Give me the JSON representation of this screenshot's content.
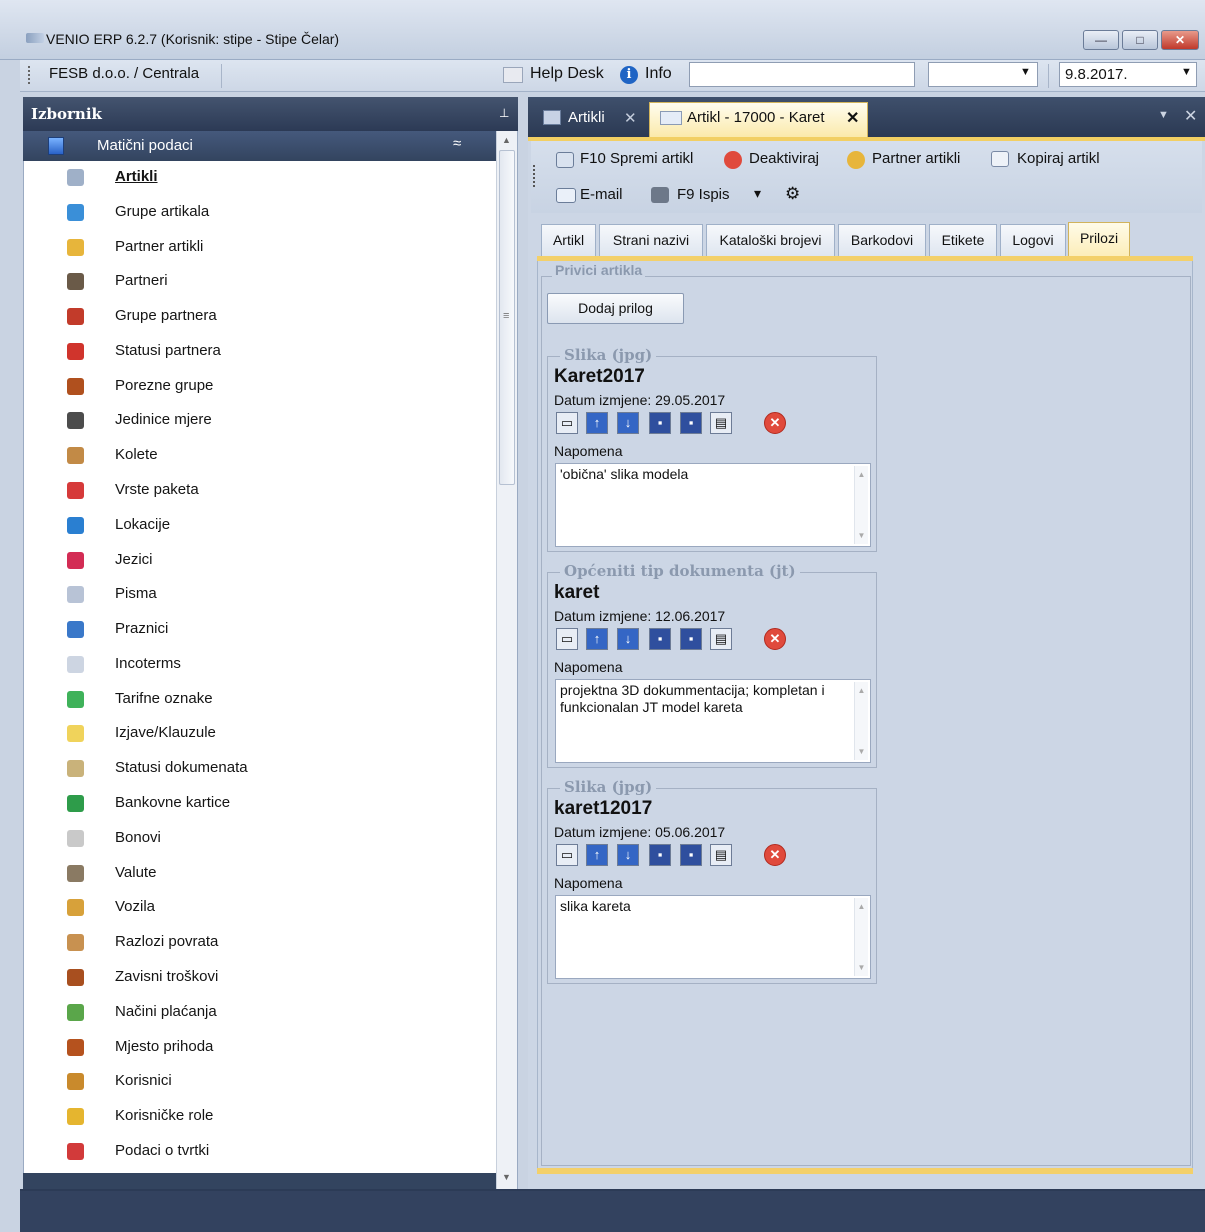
{
  "window": {
    "title": "VENIO ERP 6.2.7 (Korisnik: stipe - Stipe Čelar)",
    "minimize": "—",
    "maximize": "□",
    "close": "✕"
  },
  "topbar": {
    "company": "FESB d.o.o. / Centrala",
    "help_desk": "Help Desk",
    "info": "Info",
    "info_icon": "i",
    "search_value": "",
    "combo_value": "",
    "date": "9.8.2017.",
    "dropdown_glyph": "▼"
  },
  "sidebar": {
    "title": "Izbornik",
    "pin": "⊥",
    "group_title": "Matični podaci",
    "group_collapse": "≈",
    "scroll_up": "▲",
    "scroll_down": "▼",
    "scroll_grip": "≡",
    "items": [
      {
        "label": "Artikli",
        "icon": "articles-icon",
        "color": "#9fb0c8"
      },
      {
        "label": "Grupe artikala",
        "icon": "article-groups-icon",
        "color": "#3a8fd8"
      },
      {
        "label": "Partner artikli",
        "icon": "partner-articles-icon",
        "color": "#e7b53b"
      },
      {
        "label": "Partneri",
        "icon": "partners-icon",
        "color": "#6a5a48"
      },
      {
        "label": "Grupe partnera",
        "icon": "partner-groups-icon",
        "color": "#c23b2a"
      },
      {
        "label": "Statusi partnera",
        "icon": "partner-status-icon",
        "color": "#d0342c"
      },
      {
        "label": "Porezne grupe",
        "icon": "tax-groups-icon",
        "color": "#b0501e"
      },
      {
        "label": "Jedinice mjere",
        "icon": "units-icon",
        "color": "#4c4c4c"
      },
      {
        "label": "Kolete",
        "icon": "packages-icon",
        "color": "#c28a46"
      },
      {
        "label": "Vrste paketa",
        "icon": "package-types-icon",
        "color": "#d63a3a"
      },
      {
        "label": "Lokacije",
        "icon": "locations-icon",
        "color": "#2a7fd1"
      },
      {
        "label": "Jezici",
        "icon": "languages-icon",
        "color": "#d32c54"
      },
      {
        "label": "Pisma",
        "icon": "letters-icon",
        "color": "#b8c3d6"
      },
      {
        "label": "Praznici",
        "icon": "holidays-icon",
        "color": "#3a78c9"
      },
      {
        "label": "Incoterms",
        "icon": "incoterms-icon",
        "color": "#cdd5e2"
      },
      {
        "label": "Tarifne oznake",
        "icon": "tariff-icon",
        "color": "#3fb25a"
      },
      {
        "label": "Izjave/Klauzule",
        "icon": "statements-icon",
        "color": "#f0d35b"
      },
      {
        "label": "Statusi dokumenata",
        "icon": "document-status-icon",
        "color": "#c9b27a"
      },
      {
        "label": "Bankovne kartice",
        "icon": "bank-cards-icon",
        "color": "#2e9c4a"
      },
      {
        "label": "Bonovi",
        "icon": "vouchers-icon",
        "color": "#c9c9c9"
      },
      {
        "label": "Valute",
        "icon": "currencies-icon",
        "color": "#8a7a63"
      },
      {
        "label": "Vozila",
        "icon": "vehicles-icon",
        "color": "#d7a13a"
      },
      {
        "label": "Razlozi povrata",
        "icon": "return-reasons-icon",
        "color": "#c89150"
      },
      {
        "label": "Zavisni troškovi",
        "icon": "dependent-costs-icon",
        "color": "#a84f1f"
      },
      {
        "label": "Načini plaćanja",
        "icon": "payment-methods-icon",
        "color": "#5aa64a"
      },
      {
        "label": "Mjesto prihoda",
        "icon": "revenue-place-icon",
        "color": "#b5521e"
      },
      {
        "label": "Korisnici",
        "icon": "users-icon",
        "color": "#c98a2c"
      },
      {
        "label": "Korisničke role",
        "icon": "user-roles-icon",
        "color": "#e5b52f"
      },
      {
        "label": "Podaci o tvrtki",
        "icon": "company-data-icon",
        "color": "#d23a3a"
      }
    ]
  },
  "tabs": {
    "artikli_label": "Artikli",
    "karet_label": "Artikl - 17000 - Karet",
    "close_glyph": "✕",
    "menu_glyph": "▼",
    "close_all": "✕"
  },
  "toolbar": {
    "save": "F10 Spremi artikl",
    "deactivate": "Deaktiviraj",
    "partner_articles": "Partner artikli",
    "copy": "Kopiraj artikl",
    "email": "E-mail",
    "print": "F9 Ispis",
    "print_dropdown": "▾",
    "settings": "⚙"
  },
  "detail_tabs": [
    "Artikl",
    "Strani nazivi",
    "Kataloški brojevi",
    "Barkodovi",
    "Etikete",
    "Logovi",
    "Prilozi"
  ],
  "attachments_panel": {
    "legend": "Privici artikla",
    "add_button": "Dodaj prilog",
    "date_prefix": "Datum izmjene: ",
    "note_label": "Napomena",
    "icon_glyphs": [
      "▭",
      "↑",
      "↓",
      "▪",
      "▪",
      "▤",
      "✕"
    ],
    "scroll_glyphs": [
      "▲",
      "▼"
    ],
    "items": [
      {
        "type": "Slika  (jpg)",
        "name": "Karet2017",
        "date": "Datum izmjene: 29.05.2017",
        "note": "'obična' slika modela"
      },
      {
        "type": "Općeniti tip dokumenta  (jt)",
        "name": "karet",
        "date": "Datum izmjene: 12.06.2017",
        "note": "projektna 3D dokummentacija; kompletan i funkcionalan JT model kareta"
      },
      {
        "type": "Slika  (jpg)",
        "name": "karet12017",
        "date": "Datum izmjene: 05.06.2017",
        "note": "slika kareta"
      }
    ]
  }
}
